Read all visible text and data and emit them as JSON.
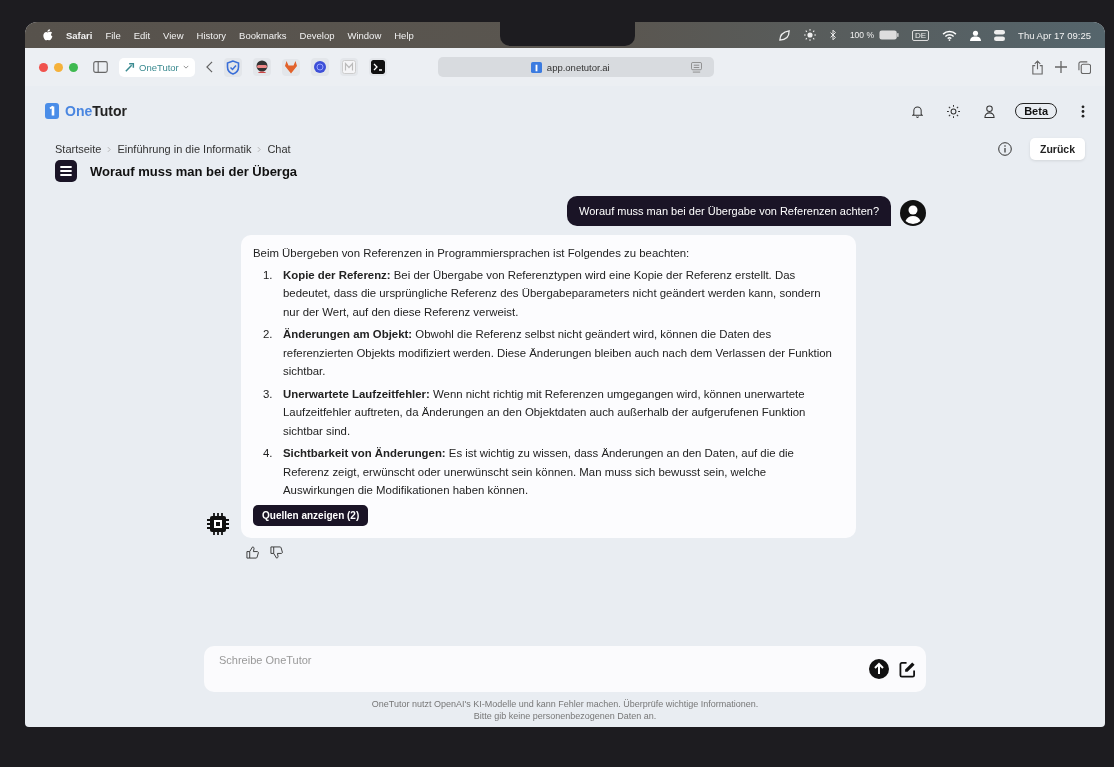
{
  "menu_bar": {
    "app": "Safari",
    "items": [
      "File",
      "Edit",
      "View",
      "History",
      "Bookmarks",
      "Develop",
      "Window",
      "Help"
    ],
    "battery": "100 %",
    "input_source": "DE",
    "clock": "Thu Apr 17  09:25"
  },
  "toolbar": {
    "tab_group": "OneTutor",
    "address": "app.onetutor.ai"
  },
  "header": {
    "brand": [
      "One",
      "Tutor"
    ],
    "badge": "Beta"
  },
  "breadcrumbs": [
    "Startseite",
    "Einführung in die Informatik",
    "Chat"
  ],
  "back_button": "Zurück",
  "chat_title": "Worauf muss man bei der Überga",
  "messages": [
    {
      "kind": "user",
      "text": "Worauf muss man bei der Übergabe von Referenzen achten?"
    },
    {
      "kind": "assistant",
      "intro": "Beim Übergeben von Referenzen in Programmiersprachen ist Folgendes zu beachten:",
      "points": [
        {
          "number": "1.",
          "title": "Kopie der Referenz:",
          "text": "Bei der Übergabe von Referenztypen wird eine Kopie der Referenz erstellt. Das bedeutet, dass die ursprüngliche Referenz des Übergabeparameters nicht geändert werden kann, sondern nur der Wert, auf den diese Referenz verweist."
        },
        {
          "number": "2.",
          "title": "Änderungen am Objekt:",
          "text": "Obwohl die Referenz selbst nicht geändert wird, können die Daten des referenzierten Objekts modifiziert werden. Diese Änderungen bleiben auch nach dem Verlassen der Funktion sichtbar."
        },
        {
          "number": "3.",
          "title": "Unerwartete Laufzeitfehler:",
          "text": "Wenn nicht richtig mit Referenzen umgegangen wird, können unerwartete Laufzeitfehler auftreten, da Änderungen an den Objektdaten auch außerhalb der aufgerufenen Funktion sichtbar sind."
        },
        {
          "number": "4.",
          "title": "Sichtbarkeit von Änderungen:",
          "text": "Es ist wichtig zu wissen, dass Änderungen an den Daten, auf die die Referenz zeigt, erwünscht oder unerwünscht sein können. Man muss sich bewusst sein, welche Auswirkungen die Modifikationen haben können."
        }
      ],
      "sources_button": "Quellen anzeigen (2)"
    }
  ],
  "composer": {
    "placeholder": "Schreibe OneTutor"
  },
  "disclaimer": [
    "OneTutor nutzt OpenAI's KI-Modelle und kann Fehler machen. Überprüfe wichtige Informationen.",
    "Bitte gib keine personenbezogenen Daten an."
  ]
}
